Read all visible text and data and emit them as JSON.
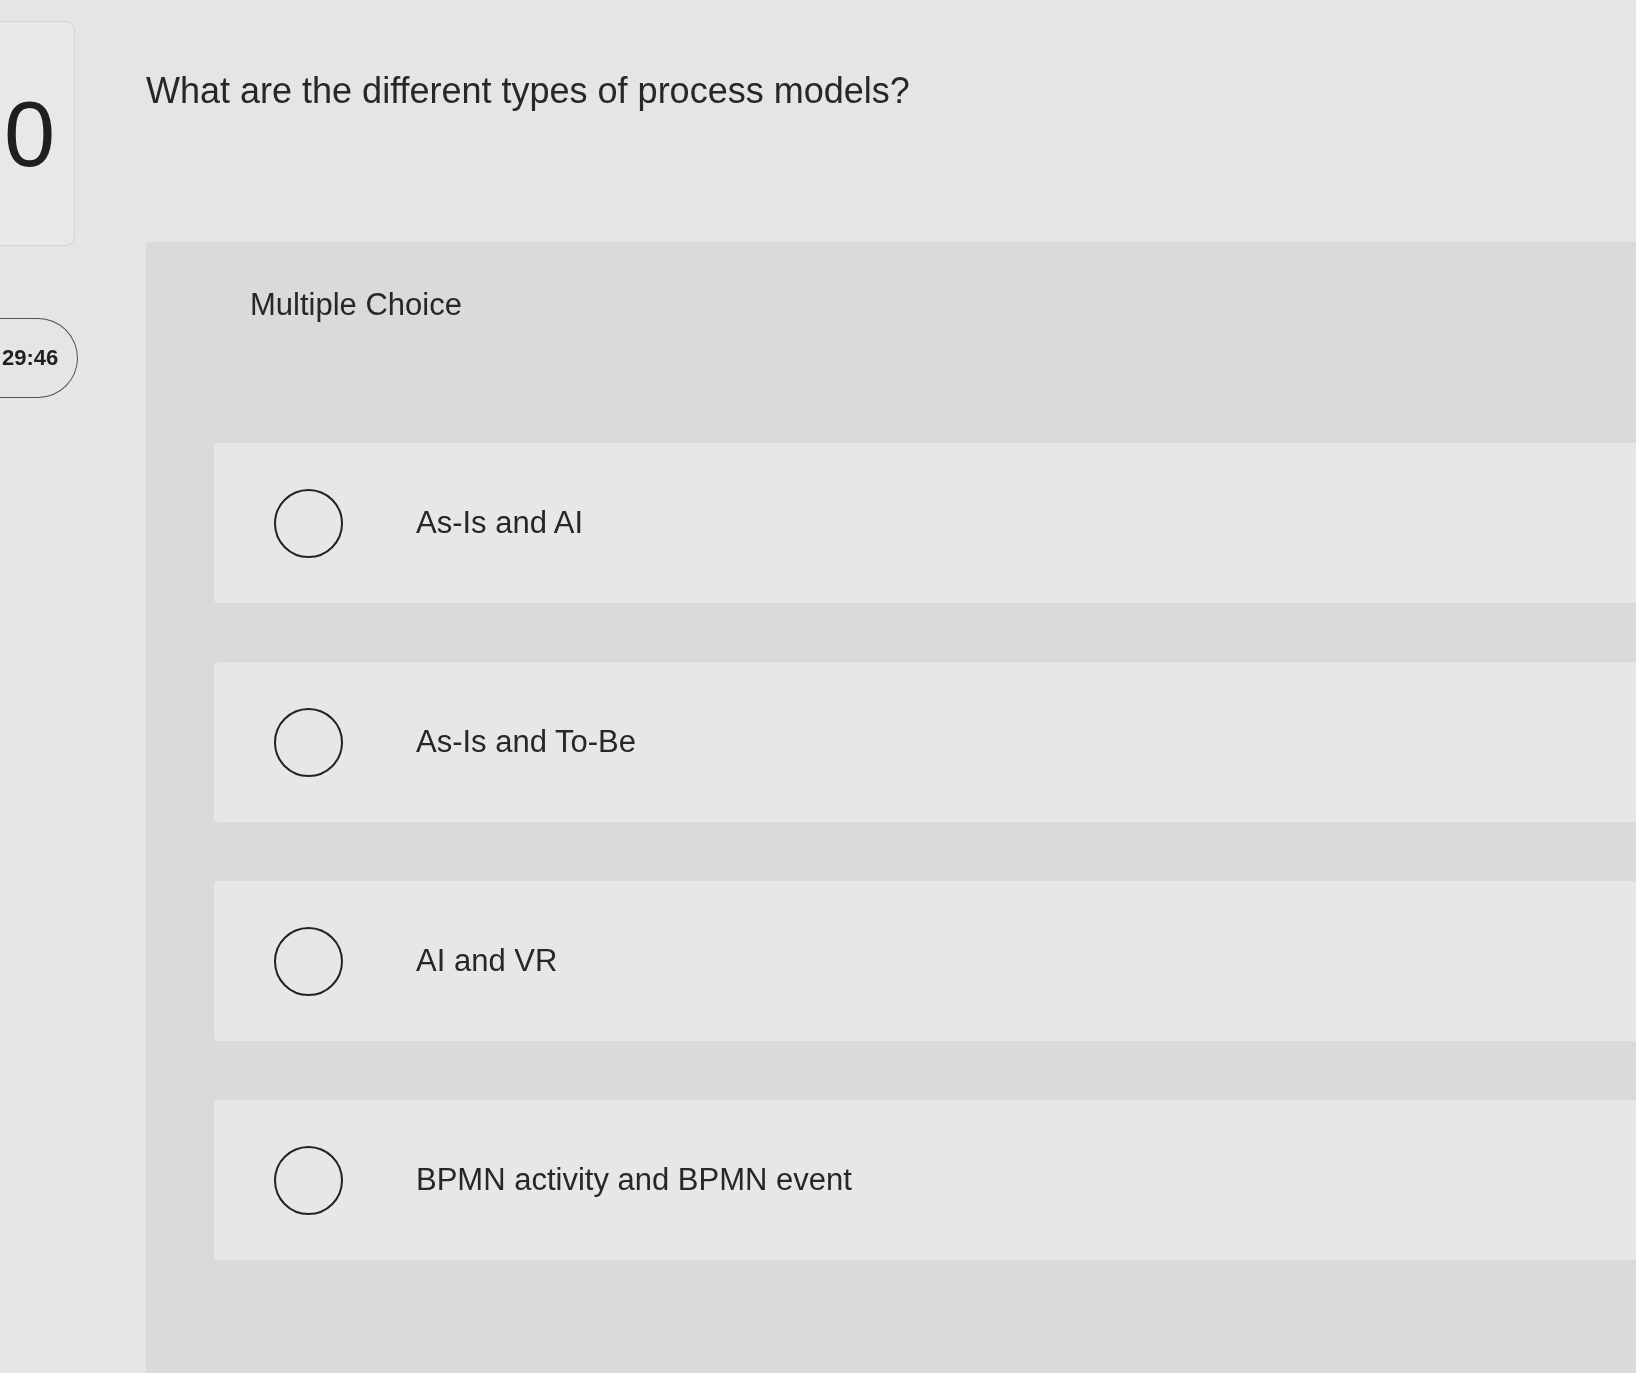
{
  "sidebar": {
    "question_number": "0",
    "timer": "29:46"
  },
  "question": {
    "text": "What are the different types of process models?",
    "type_label": "Multiple Choice",
    "options": [
      {
        "label": "As-Is and AI",
        "selected": false
      },
      {
        "label": "As-Is and To-Be",
        "selected": false
      },
      {
        "label": "AI and VR",
        "selected": false
      },
      {
        "label": "BPMN activity and BPMN event",
        "selected": false
      }
    ]
  }
}
